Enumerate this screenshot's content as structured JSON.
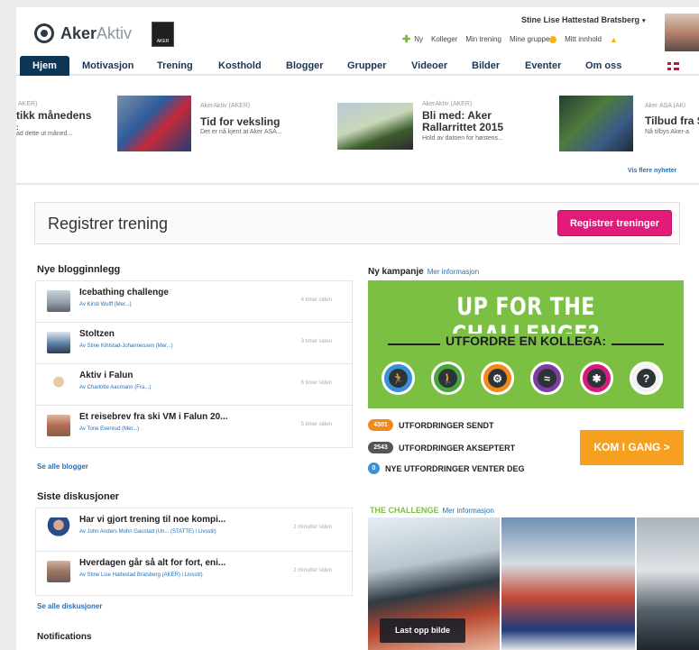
{
  "header": {
    "logo_bold": "Aker",
    "logo_light": "Aktiv",
    "badge_text": "AKER",
    "user_name": "Stine Lise Hattestad Bratsberg",
    "links": [
      "Ny",
      "Kolleger",
      "Min trening",
      "Mine grupper",
      "Mitt innhold"
    ]
  },
  "nav": [
    "Hjem",
    "Motivasjon",
    "Trening",
    "Kosthold",
    "Blogger",
    "Grupper",
    "Videoer",
    "Bilder",
    "Eventer",
    "Om oss"
  ],
  "news": [
    {
      "source": "AKER)",
      "title1": "tikk månedens",
      "title2": ":",
      "desc": "ad dette ut måned..."
    },
    {
      "source": "AkerAktiv (AKER)",
      "title1": "Tid for veksling",
      "title2": "",
      "desc": "Det er nå kjent at Aker ASA..."
    },
    {
      "source": "AkerAktiv (AKER)",
      "title1": "Bli med: Aker",
      "title2": "Rallarrittet 2015",
      "desc": "Hold av datoen for høstens..."
    },
    {
      "source": "Aker ASA (AKI",
      "title1": "Tilbud fra S",
      "title2": "",
      "desc": "Nå tilbys Aker-a"
    }
  ],
  "more_news": "Vis flere nyheter",
  "register": {
    "title": "Registrer trening",
    "button": "Registrer treninger"
  },
  "blogs": {
    "title": "Nye blogginnlegg",
    "items": [
      {
        "title": "Icebathing challenge",
        "author": "Av Kirsti Wulff (Mer...)",
        "time": "4 timer siden"
      },
      {
        "title": "Stoltzen",
        "author": "Av Stine Kihlstad-Johannessen (Mer...)",
        "time": "3 timer siden"
      },
      {
        "title": "Aktiv i Falun",
        "author": "Av Charlotte Aasmann (Fra...)",
        "time": "6 timer siden"
      },
      {
        "title": "Et reisebrev fra ski VM i Falun 20...",
        "author": "Av Tone Evenrud (Mer...)",
        "time": "5 timer siden"
      }
    ],
    "see_all": "Se alle blogger"
  },
  "discussions": {
    "title": "Siste diskusjoner",
    "items": [
      {
        "title": "Har vi gjort trening til noe kompi...",
        "author": "Av John Anders Mohn Gaustad (Un... (STATTE) i Livsstil)",
        "time": "2 minutter siden"
      },
      {
        "title": "Hverdagen går så alt for fort, eni...",
        "author": "Av Stine Lise Hattestad Bratsberg (AKER) i Livsstil)",
        "time": "2 minutter siden"
      }
    ],
    "see_all": "Se alle diskusjoner"
  },
  "notifications_title": "Notifications",
  "campaign": {
    "head": "Ny kampanje",
    "more": "Mer informasjon",
    "title": "UP FOR THE CHALLENGE?",
    "subtitle": "UTFORDRE EN KOLLEGA:",
    "icon_names": [
      "run-icon",
      "walk-icon",
      "bike-icon",
      "swim-icon",
      "spin-icon",
      "question-icon"
    ],
    "icon_colors": [
      "#3b8fd6",
      "#4aa33e",
      "#f08a1b",
      "#7b3fa0",
      "#d81b7b",
      "#2d3438"
    ],
    "stats": [
      {
        "value": "4301",
        "label": "UTFORDRINGER SENDT",
        "color": "#f08a1b"
      },
      {
        "value": "2543",
        "label": "UTFORDRINGER AKSEPTERT",
        "color": "#555555"
      },
      {
        "value": "0",
        "label": "NYE UTFORDRINGER VENTER DEG",
        "color": "#3b8fd6"
      }
    ],
    "cta": "KOM I GANG >"
  },
  "challenge": {
    "head": "THE CHALLENGE",
    "more": "Mer informasjon",
    "upload": "Last opp bilde"
  }
}
